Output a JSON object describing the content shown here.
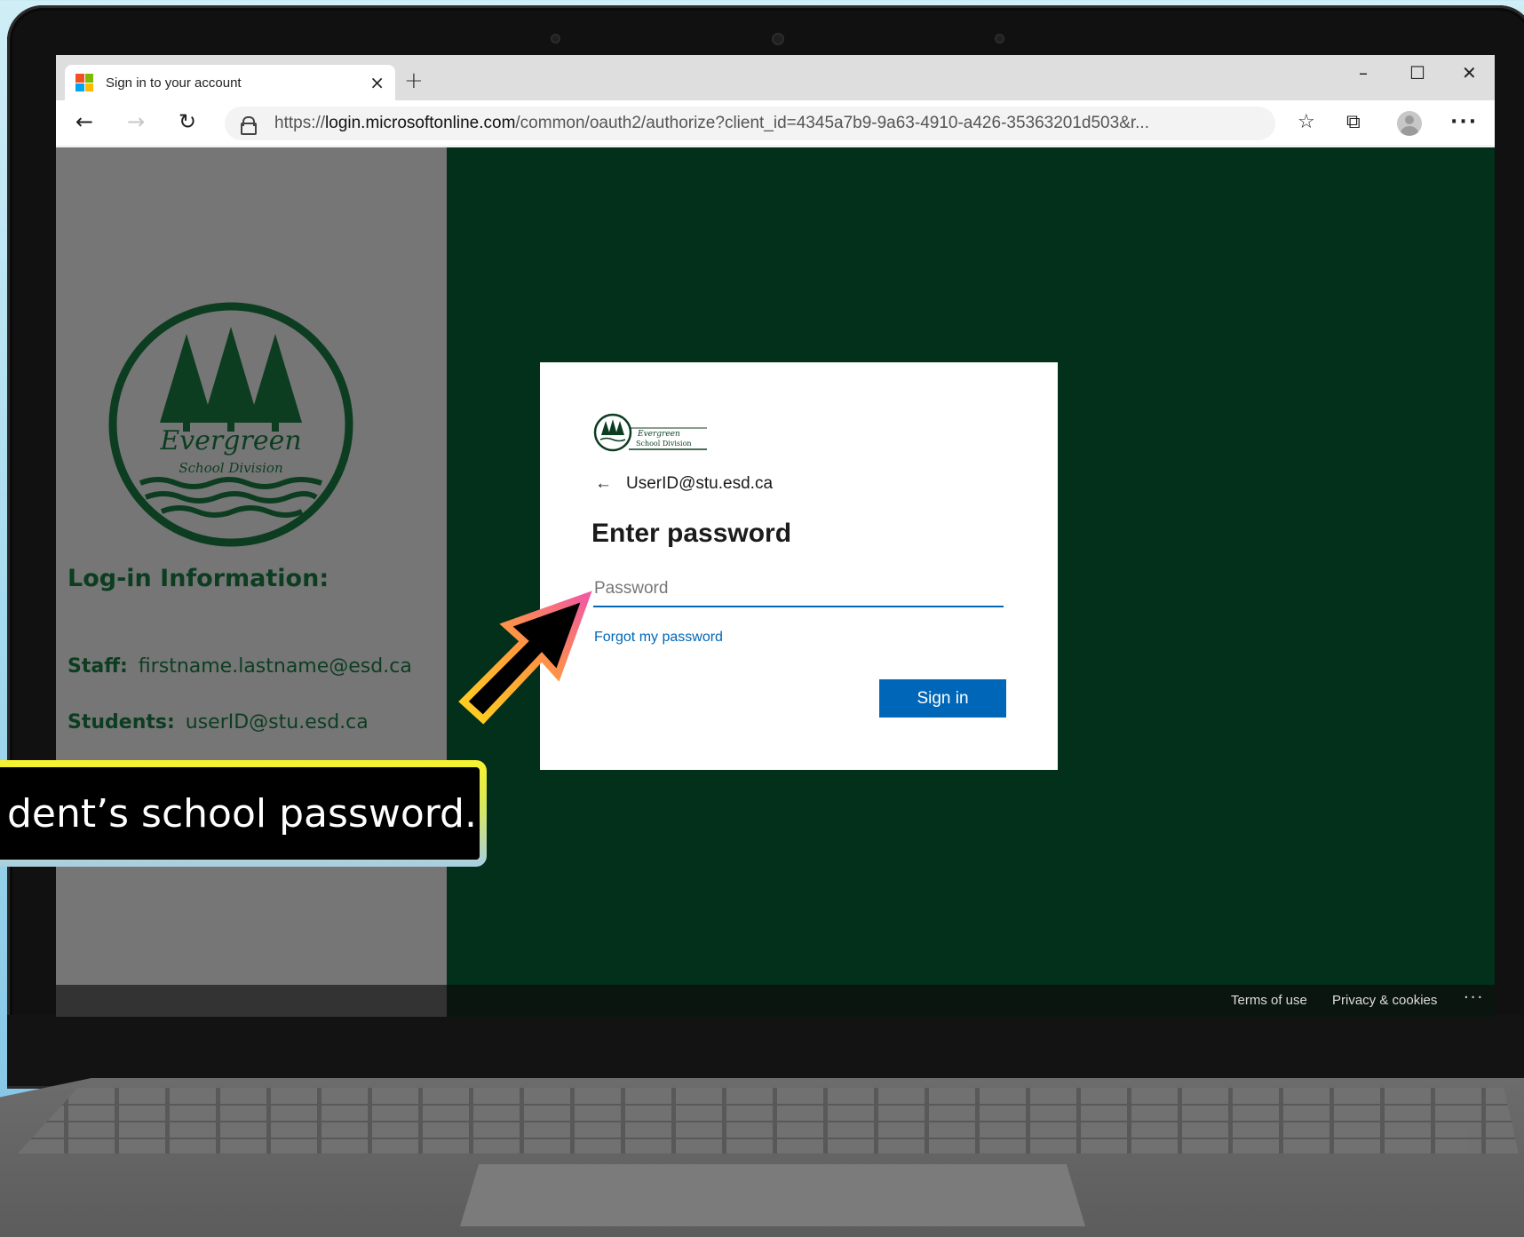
{
  "browser": {
    "tab_title": "Sign in to your account",
    "tab_close": "×",
    "new_tab": "+",
    "window_controls": {
      "minimize": "–",
      "maximize": "☐",
      "close": "✕"
    },
    "nav": {
      "back": "←",
      "forward": "→",
      "refresh": "↻"
    },
    "url_prefix": "https://",
    "url_host": "login.microsoftonline.com",
    "url_path": "/common/oauth2/authorize?client_id=4345a7b9-9a63-4910-a426-35363201d503&r...",
    "toolbar_icons": [
      "favorites-icon",
      "collections-icon",
      "profile-icon",
      "more-icon"
    ],
    "more": "···",
    "favorites": "☆",
    "collections": "⧉"
  },
  "left_panel": {
    "logo_text_line1": "Evergreen",
    "logo_text_line2": "School Division",
    "title": "Log-in Information:",
    "staff_label": "Staff:",
    "staff_value": "firstname.lastname@esd.ca",
    "students_label": "Students:",
    "students_value": "userID@stu.esd.ca"
  },
  "card": {
    "logo_line1": "Evergreen",
    "logo_line2": "School Division",
    "back_arrow": "←",
    "identity": "UserID@stu.esd.ca",
    "title": "Enter password",
    "password_placeholder": "Password",
    "forgot_link": "Forgot my password",
    "signin_button": "Sign in"
  },
  "footer": {
    "terms": "Terms of use",
    "privacy": "Privacy & cookies",
    "more": "···"
  },
  "overlay": {
    "caption": "dent’s school password."
  },
  "colors": {
    "left_panel_bg": "#767676",
    "right_panel_bg": "#02301a",
    "brand_green": "#0c3d21",
    "accent_blue": "#0067b8"
  }
}
